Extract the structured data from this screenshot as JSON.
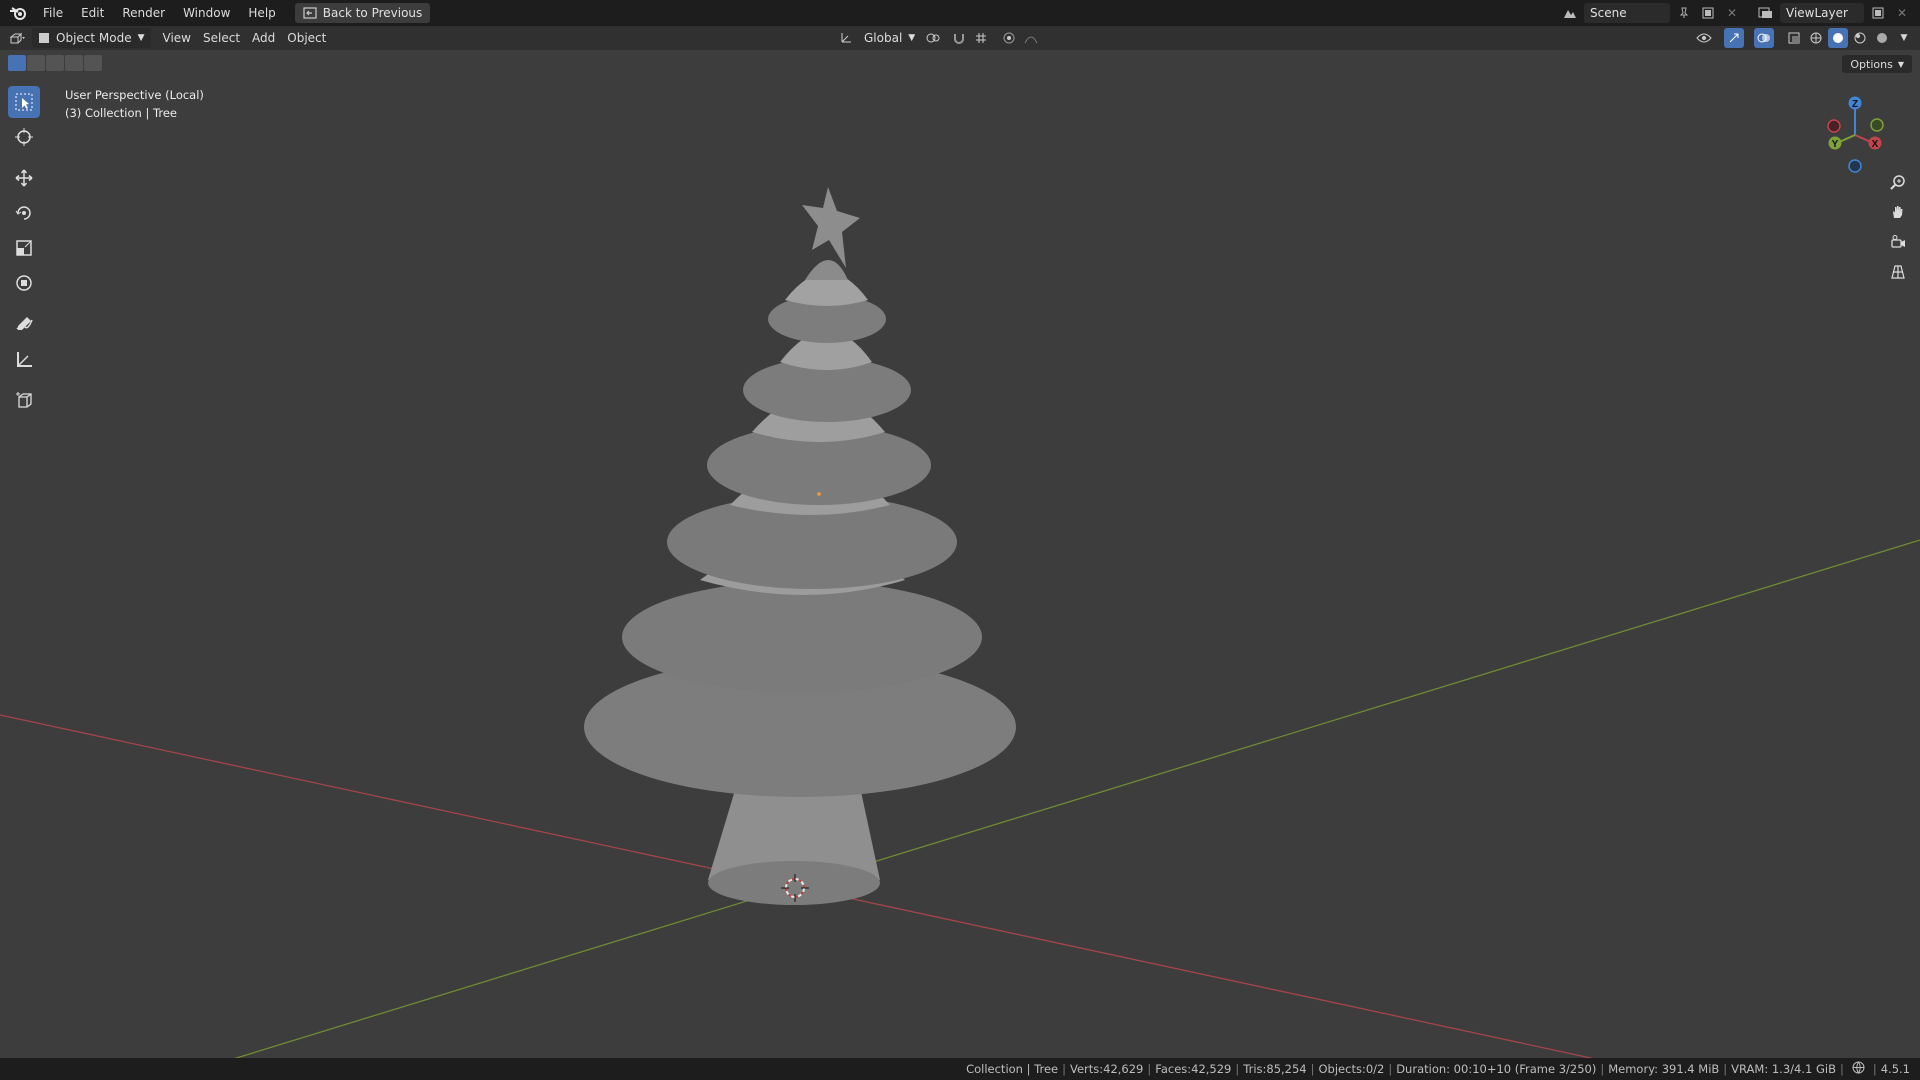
{
  "topbar": {
    "menus": [
      "File",
      "Edit",
      "Render",
      "Window",
      "Help"
    ],
    "back_label": "Back to Previous",
    "scene": "Scene",
    "view_layer": "ViewLayer"
  },
  "header": {
    "mode": "Object Mode",
    "menus": [
      "View",
      "Select",
      "Add",
      "Object"
    ],
    "orientation": "Global",
    "options": "Options"
  },
  "viewport": {
    "perspective": "User Perspective (Local)",
    "collection": "(3) Collection | Tree"
  },
  "gizmo": {
    "z": "Z",
    "y": "Y",
    "x": "X"
  },
  "status": {
    "items": [
      "Collection | Tree",
      "Verts:42,629",
      "Faces:42,529",
      "Tris:85,254",
      "Objects:0/2",
      "Duration: 00:10+10 (Frame 3/250)",
      "Memory: 391.4 MiB",
      "VRAM: 1.3/4.1 GiB",
      "4.5.1"
    ]
  },
  "colors": {
    "accent": "#4772b3",
    "x_axis": "#c2454c",
    "y_axis": "#7fa23a",
    "z_axis": "#3f86d4"
  }
}
